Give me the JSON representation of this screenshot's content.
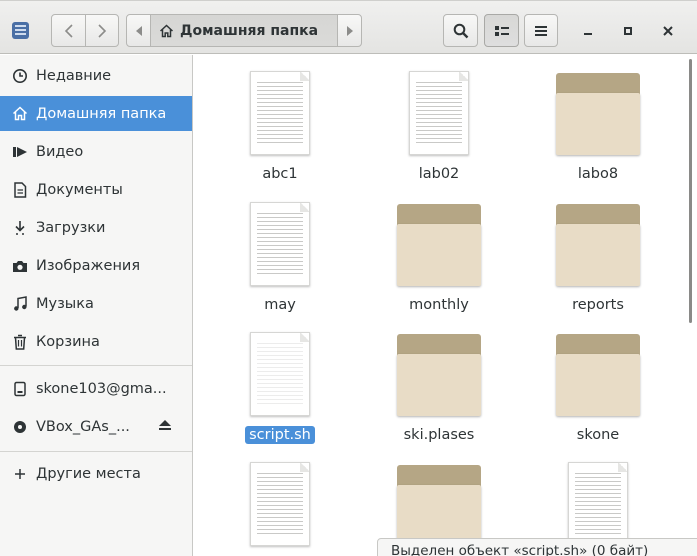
{
  "window": {
    "path_label": "Домашняя папка"
  },
  "toolbar": {
    "back_icon": "go-back-icon",
    "forward_icon": "go-forward-icon",
    "search_icon": "search-icon",
    "view_icon": "list-view-icon",
    "menu_icon": "menu-icon",
    "minimize_icon": "minimize-icon",
    "maximize_icon": "maximize-icon",
    "close_icon": "close-icon"
  },
  "sidebar": {
    "items": [
      {
        "label": "Недавние",
        "icon": "clock-icon"
      },
      {
        "label": "Домашняя папка",
        "icon": "home-icon",
        "active": true
      },
      {
        "label": "Видео",
        "icon": "video-icon"
      },
      {
        "label": "Документы",
        "icon": "document-icon"
      },
      {
        "label": "Загрузки",
        "icon": "download-icon"
      },
      {
        "label": "Изображения",
        "icon": "camera-icon"
      },
      {
        "label": "Музыка",
        "icon": "music-icon"
      },
      {
        "label": "Корзина",
        "icon": "trash-icon"
      },
      {
        "label": "skone103@gma...",
        "icon": "network-drive-icon"
      },
      {
        "label": "VBox_GAs_...",
        "icon": "disc-icon"
      },
      {
        "label": "Другие места",
        "icon": "plus-icon"
      }
    ]
  },
  "files": [
    {
      "name": "abc1",
      "type": "document"
    },
    {
      "name": "lab02",
      "type": "document"
    },
    {
      "name": "labo8",
      "type": "folder"
    },
    {
      "name": "may",
      "type": "document"
    },
    {
      "name": "monthly",
      "type": "folder"
    },
    {
      "name": "reports",
      "type": "folder"
    },
    {
      "name": "script.sh",
      "type": "script",
      "selected": true
    },
    {
      "name": "ski.plases",
      "type": "folder"
    },
    {
      "name": "skone",
      "type": "folder"
    },
    {
      "name": "",
      "type": "document"
    },
    {
      "name": "",
      "type": "folder"
    },
    {
      "name": "",
      "type": "document"
    }
  ],
  "status": {
    "text": "Выделен объект «script.sh» (0 байт)"
  },
  "colors": {
    "accent": "#4a90d9",
    "folder_back": "#b5a685",
    "folder_front": "#e8dcc6"
  }
}
